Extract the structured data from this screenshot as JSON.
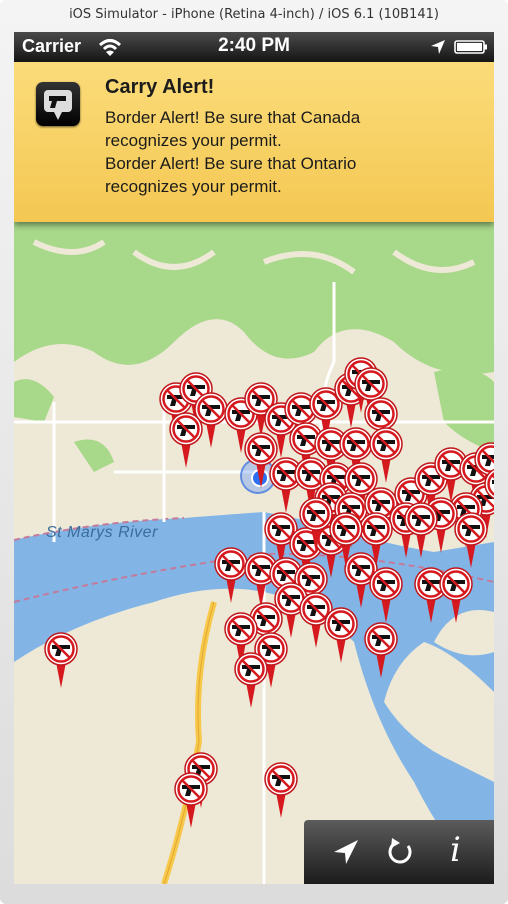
{
  "window": {
    "title": "iOS Simulator - iPhone (Retina 4-inch) / iOS 6.1 (10B141)"
  },
  "status_bar": {
    "carrier": "Carrier",
    "time": "2:40 PM"
  },
  "alert": {
    "title": "Carry Alert!",
    "lines": [
      "Border Alert! Be sure that Canada",
      "recognizes your permit.",
      "Border Alert! Be sure that Ontario",
      "recognizes your permit."
    ]
  },
  "map": {
    "label_river": "St Marys River",
    "colors": {
      "land": "#eee8d6",
      "water": "#82b5e6",
      "park": "#a8d88a",
      "road": "#ffffff",
      "highway": "#f7c84a"
    }
  },
  "toolbar": {
    "info_label": "i"
  },
  "icons": [
    "wifi-icon",
    "location-arrow-icon",
    "battery-icon",
    "no-gun-pin-icon",
    "locate-arrow-icon",
    "refresh-icon",
    "info-icon"
  ]
}
